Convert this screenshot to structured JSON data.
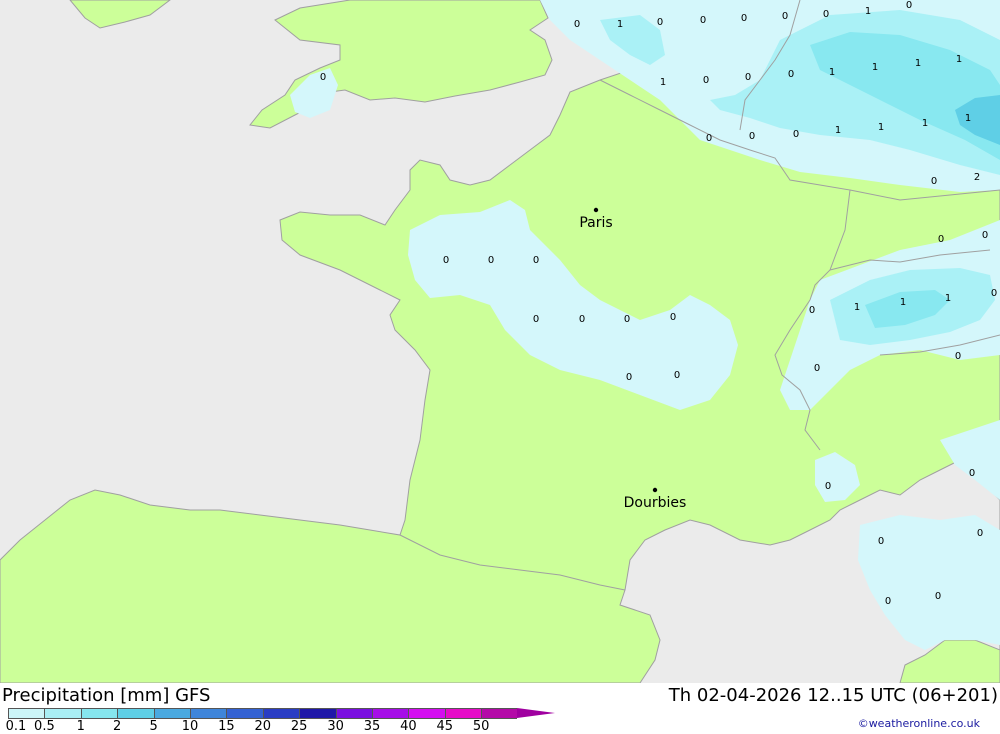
{
  "map": {
    "cities": [
      {
        "name": "Paris"
      },
      {
        "name": "Dourbies"
      }
    ],
    "values": [
      "0",
      "1",
      "0",
      "0",
      "0",
      "0",
      "0",
      "1",
      "0",
      "0",
      "0",
      "1",
      "0",
      "0",
      "1",
      "1",
      "1",
      "1",
      "0",
      "0",
      "0",
      "1",
      "1",
      "1",
      "1",
      "2",
      "0",
      "0",
      "0",
      "0",
      "0",
      "0",
      "0",
      "0",
      "0",
      "0",
      "0",
      "1",
      "1",
      "1",
      "0",
      "0",
      "0",
      "0",
      "0",
      "0",
      "0",
      "0",
      "0",
      "0"
    ]
  },
  "footer": {
    "title": "Precipitation [mm] GFS",
    "datetime": "Th 02-04-2026 12..15 UTC (06+201)",
    "credit": "©weatheronline.co.uk",
    "scale_labels": [
      "0.1",
      "0.5",
      "1",
      "2",
      "5",
      "10",
      "15",
      "20",
      "25",
      "30",
      "35",
      "40",
      "45",
      "50"
    ],
    "scale_colors": [
      "#ccf5f8",
      "#a9eef4",
      "#86e6ee",
      "#5fcfe6",
      "#4aa9e0",
      "#3f85da",
      "#3462d3",
      "#2a3dc4",
      "#1f18a8",
      "#7a10e0",
      "#a60ee8",
      "#d40ef0",
      "#e60cc8",
      "#b40aa8"
    ]
  }
}
